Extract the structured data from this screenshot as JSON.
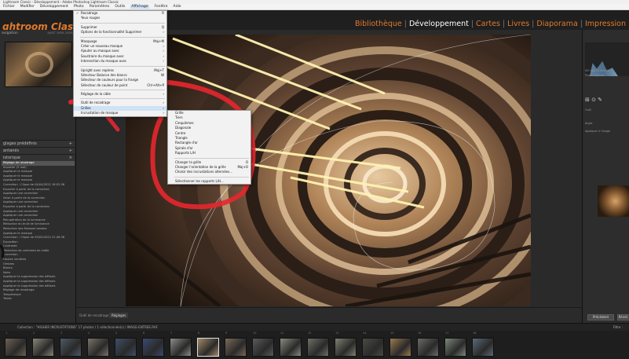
{
  "window": {
    "title": "Lightroom Classic - Développement - Adobe Photoshop Lightroom Classic"
  },
  "menubar": [
    "Fichier",
    "Modifier",
    "Développement",
    "Photo",
    "Paramètres",
    "Outils",
    "Affichage",
    "Fenêtre",
    "Aide"
  ],
  "active_menu": "Affichage",
  "brand": "ghtroom Classic - D",
  "modules": [
    {
      "label": "Bibliothèque",
      "current": false
    },
    {
      "label": "Développement",
      "current": true
    },
    {
      "label": "Cartes",
      "current": false
    },
    {
      "label": "Livres",
      "current": false
    },
    {
      "label": "Diaporama",
      "current": false
    },
    {
      "label": "Impression",
      "current": false
    }
  ],
  "left_panel": {
    "navigator_label": "avigation",
    "zoom": "AJUST  100%  200%",
    "sections": {
      "presets": "glages prédéfinis",
      "snapshots": "antanés",
      "history": "istorique"
    },
    "history_items": [
      "Réglage de recadrage",
      "Importer (5 mai)",
      "Appliquer le masque",
      "Appliquer le masque",
      "Appliquer le masque",
      "Correction : Clique de 04/04/2022 16:52:36",
      "Exporter à partir de la correction",
      "Appliquer une correction",
      "Saisir à partir de la correction",
      "Appliquer une correction",
      "Exporter à partir de la correction",
      "Appliquer une correction",
      "Appliquer une correction",
      "Récupération de la luminance",
      "Réduction du bruit de luminance",
      "Réduction des finesses tonales",
      "Appliquer le masque",
      "Correction : Clique de 05/05/2022 21:46:36",
      "Exposition",
      "Contraste",
      "Réduction de contraste de vidéo",
      "Correction",
      "Hautes lumières",
      "Ombres",
      "Blancs",
      "Noirs",
      "Appliquer la suppression des défauts",
      "Appliquer la suppression des défauts",
      "Appliquer la suppression des défauts",
      "Réglage de recadrage",
      "Température",
      "Teinte"
    ],
    "selected_history": 0,
    "buttons": {
      "copy": "Copier",
      "paste": "Coller"
    }
  },
  "toolbar": {
    "label": "Outil de recadrage :",
    "value": "Réglages"
  },
  "menus": {
    "affichage": [
      {
        "label": "Recadrage",
        "shortcut": "R",
        "checked": true
      },
      {
        "label": "Yeux rouges",
        "shortcut": ""
      },
      {
        "sep": true
      },
      {
        "label": "Supprimer",
        "shortcut": "Q"
      },
      {
        "label": "Options de la fonctionnalité Supprimer",
        "arrow": true
      },
      {
        "sep": true
      },
      {
        "label": "Masquage",
        "shortcut": "Maj+M"
      },
      {
        "label": "Créer un nouveau masque",
        "arrow": true
      },
      {
        "label": "Ajouter au masque avec",
        "arrow": true
      },
      {
        "label": "Soustraire du masque avec",
        "arrow": true
      },
      {
        "label": "Intersection du masque avec",
        "arrow": true
      },
      {
        "sep": true
      },
      {
        "label": "Upright avec repères",
        "shortcut": "Maj+T"
      },
      {
        "label": "Sélecteur Balance des blancs",
        "shortcut": "W"
      },
      {
        "label": "Sélecteur de couleurs pour la frange",
        "shortcut": ""
      },
      {
        "label": "Sélecteur de couleur de point",
        "shortcut": "Ctrl+Alt+P"
      },
      {
        "sep": true
      },
      {
        "label": "Réglage de la cible",
        "arrow": true
      },
      {
        "sep": true
      },
      {
        "label": "Outil de recadrage",
        "arrow": true
      },
      {
        "label": "Grilles",
        "arrow": true,
        "highlight": true
      },
      {
        "label": "Incrustation de masque",
        "arrow": true
      }
    ],
    "grilles": [
      {
        "label": "Grille"
      },
      {
        "label": "Tiers"
      },
      {
        "label": "Cinquièmes"
      },
      {
        "label": "Diagonale"
      },
      {
        "label": "Centre"
      },
      {
        "label": "Triangle"
      },
      {
        "label": "Rectangle d'or"
      },
      {
        "label": "Spirale d'or"
      },
      {
        "label": "Rapports L/H"
      },
      {
        "sep": true
      },
      {
        "label": "Changer la grille",
        "shortcut": "O"
      },
      {
        "label": "Changer l'orientation de la grille",
        "shortcut": "Maj+O"
      },
      {
        "label": "Choisir des incrustations alternées..."
      },
      {
        "sep": true
      },
      {
        "label": "Sélectionner les rapports L/H..."
      }
    ]
  },
  "right_panel": {
    "histogram_info": "ISO 400   24 mm   f/4",
    "original": "Photo originale",
    "crop_label": "Outil",
    "angle": "Angle",
    "straighten": "Appliquer à l'image",
    "buttons": {
      "previous": "Précédent",
      "reset": "Réinit."
    }
  },
  "filmstrip": {
    "info": "Collection : \"HIGHER INCRUSTATIONS\"   17 photos / 1 sélectionnée(s) / IMAGE-ENTREE.RAF",
    "filter": "Filtre :",
    "thumbs": [
      {
        "n": "1",
        "c": "#6d6253"
      },
      {
        "n": "2",
        "c": "#8a8478"
      },
      {
        "n": "3",
        "c": "#4e5a66"
      },
      {
        "n": "4",
        "c": "#7a7268"
      },
      {
        "n": "5",
        "c": "#3f4f68"
      },
      {
        "n": "6",
        "c": "#3a4a70"
      },
      {
        "n": "7",
        "c": "#8c8c8a"
      },
      {
        "n": "8",
        "c": "#a48a6a"
      },
      {
        "n": "9",
        "c": "#7b6a58"
      },
      {
        "n": "10",
        "c": "#5a5a5a"
      },
      {
        "n": "11",
        "c": "#8a8a80"
      },
      {
        "n": "12",
        "c": "#6e7064"
      },
      {
        "n": "13",
        "c": "#808070"
      },
      {
        "n": "14",
        "c": "#4a4a44"
      },
      {
        "n": "15",
        "c": "#9a7a50"
      },
      {
        "n": "16",
        "c": "#6a6a68"
      },
      {
        "n": "17",
        "c": "#7c8a7a"
      },
      {
        "n": "18",
        "c": "#5a6a78"
      }
    ]
  },
  "colors": {
    "brand": "#e07a2e",
    "annotation": "#e6272f",
    "menu_highlight": "#cfe2f6"
  }
}
